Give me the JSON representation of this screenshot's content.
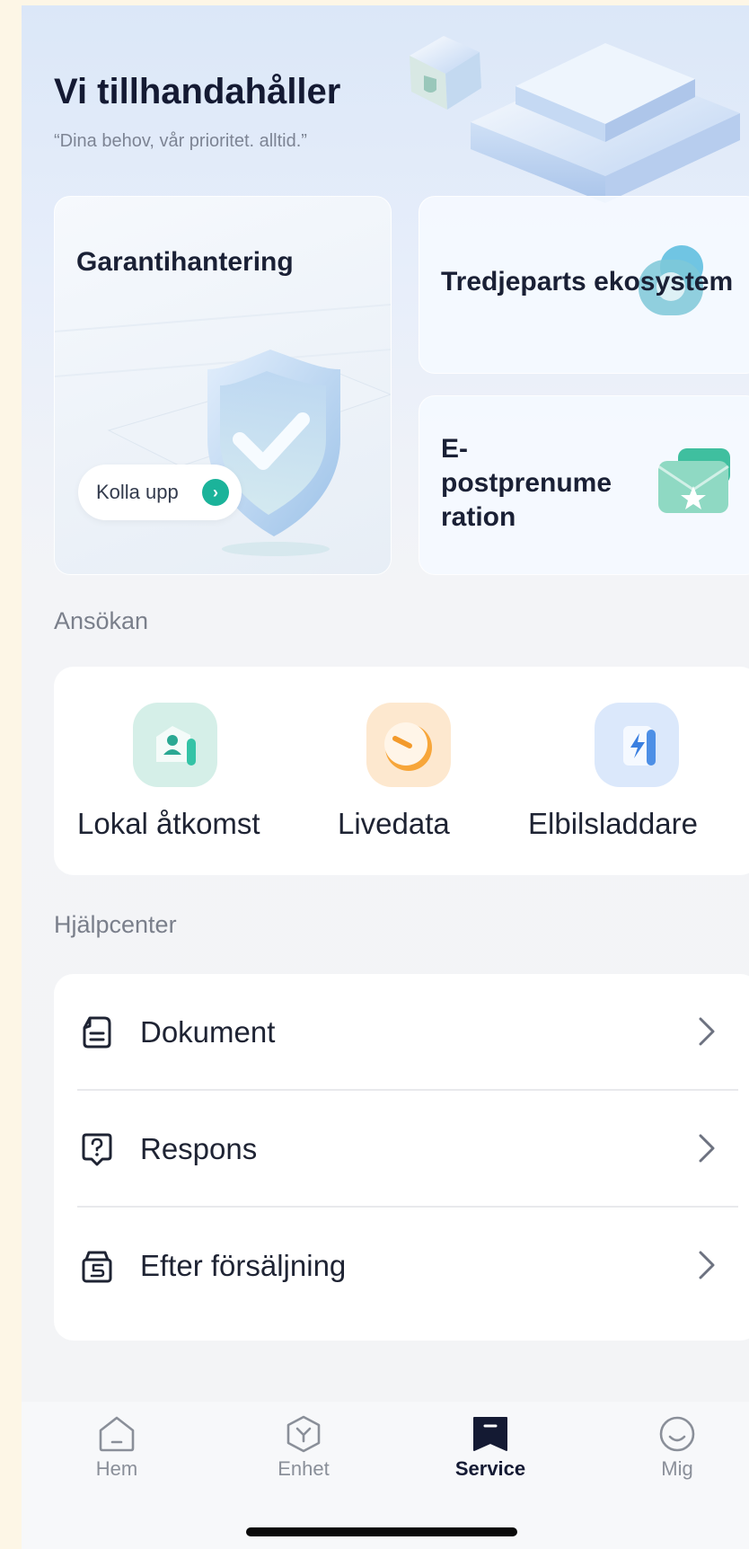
{
  "header": {
    "title": "Vi tillhandahåller",
    "subtitle": "“Dina behov, vår prioritet. alltid.”"
  },
  "cards": {
    "warranty": {
      "title": "Garantihantering",
      "button_label": "Kolla upp"
    },
    "thirdparty": {
      "title": "Tredjeparts ekosystem"
    },
    "email": {
      "title_lines": [
        "E-",
        "postprenume",
        "ration"
      ]
    }
  },
  "apps_section": {
    "label": "Ansökan",
    "items": [
      {
        "label": "Lokal åtkomst",
        "icon": "local-access-icon"
      },
      {
        "label": "Livedata",
        "icon": "live-data-icon"
      },
      {
        "label": "Elbilsladdare",
        "icon": "ev-charger-icon"
      }
    ]
  },
  "help_section": {
    "label": "Hjälpcenter",
    "items": [
      {
        "label": "Dokument",
        "icon": "document-icon"
      },
      {
        "label": "Respons",
        "icon": "feedback-icon"
      },
      {
        "label": "Efter försäljning",
        "icon": "after-sales-icon"
      }
    ]
  },
  "tabbar": {
    "tabs": [
      {
        "label": "Hem",
        "icon": "home-icon",
        "active": false
      },
      {
        "label": "Enhet",
        "icon": "device-icon",
        "active": false
      },
      {
        "label": "Service",
        "icon": "service-icon",
        "active": true
      },
      {
        "label": "Mig",
        "icon": "profile-icon",
        "active": false
      }
    ]
  },
  "colors": {
    "accent": "#1bb39a",
    "title_text": "#141a33",
    "muted_text": "#7a7f8b"
  }
}
